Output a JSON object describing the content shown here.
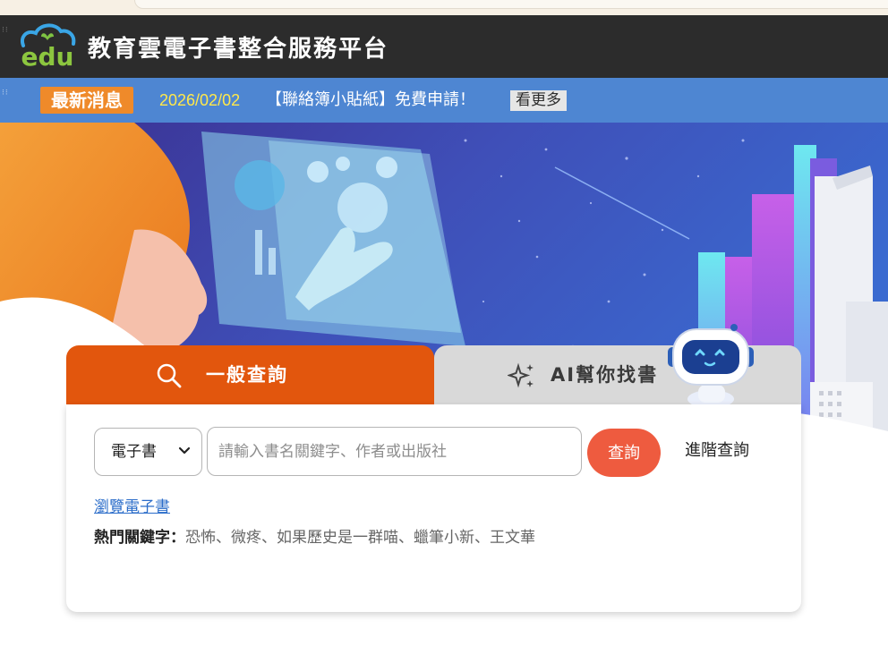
{
  "site": {
    "logo_text": "edu",
    "title": "教育雲電子書整合服務平台"
  },
  "news": {
    "badge": "最新消息",
    "date": "2026/02/02",
    "text": "【聯絡簿小貼紙】免費申請！",
    "more": "看更多"
  },
  "tabs": {
    "general": "一般查詢",
    "ai": "AI幫你找書"
  },
  "search": {
    "type_value": "電子書",
    "placeholder": "請輸入書名關鍵字、作者或出版社",
    "query_button": "查詢",
    "advanced": "進階查詢"
  },
  "browse": "瀏覽電子書",
  "hot_keywords": {
    "label": "熱門關鍵字：",
    "items": [
      "恐怖",
      "微疼",
      "如果歷史是一群喵",
      "蠟筆小新",
      "王文華"
    ],
    "separator": "、"
  },
  "colors": {
    "header_bg": "#2c2c2c",
    "news_bar": "#4e86d2",
    "badge": "#ef8a2a",
    "date": "#ffe84a",
    "tab_active": "#e2560d",
    "tab_inactive": "#d9d9d9",
    "query_button": "#ee5b3f",
    "link": "#2a6cc9"
  },
  "icons": [
    "cloud-logo-icon",
    "search-icon",
    "sparkle-icon",
    "chevron-down-icon",
    "robot-mascot-icon"
  ]
}
